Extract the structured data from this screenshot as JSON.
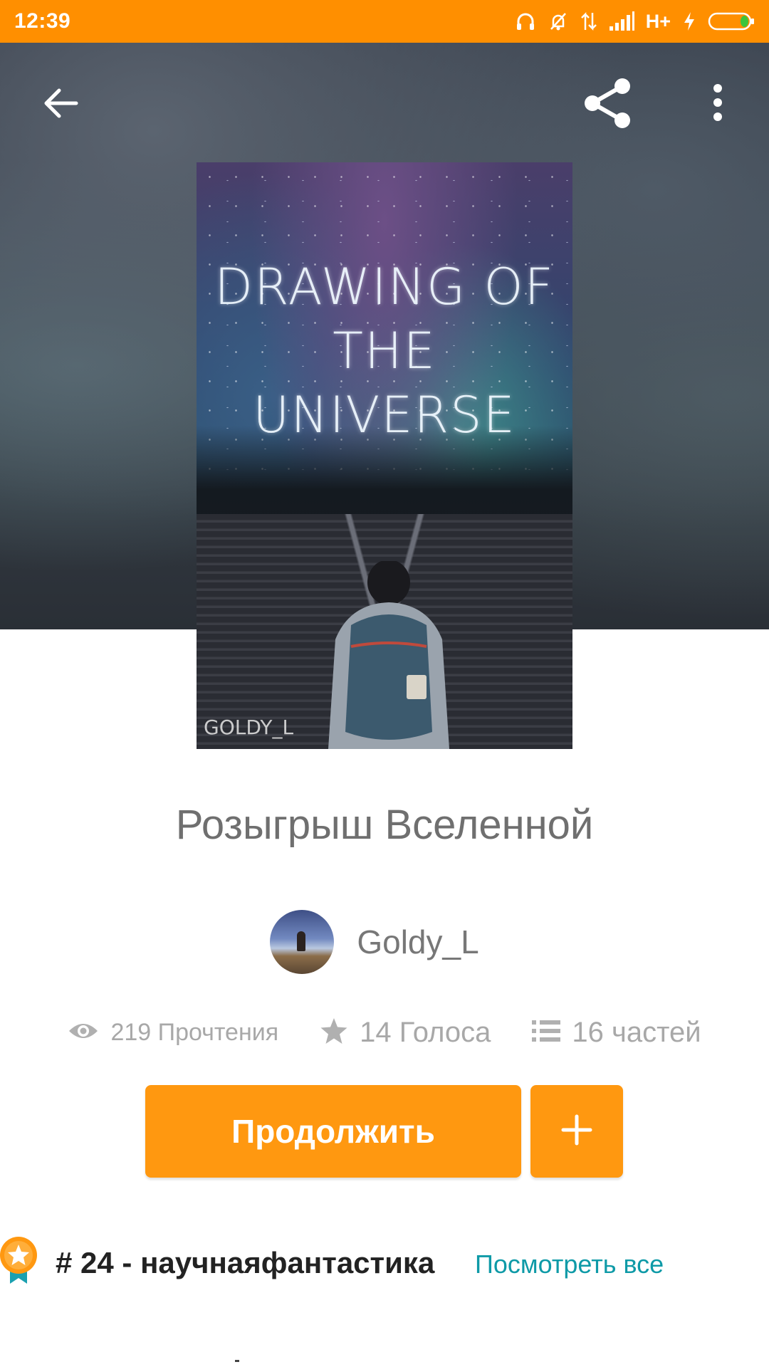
{
  "status_bar": {
    "time": "12:39",
    "network": "H+",
    "icons": [
      "headset-icon",
      "bell-off-icon",
      "data-arrows-icon",
      "signal-icon",
      "charging-icon",
      "battery-icon"
    ]
  },
  "toolbar": {
    "icons": [
      "back-arrow-icon",
      "share-icon",
      "more-vert-icon"
    ]
  },
  "cover": {
    "title_line1": "DRAWING OF",
    "title_line2": "THE UNIVERSE",
    "author_mark": "GOLDY_L"
  },
  "story": {
    "title": "Розыгрыш Вселенной",
    "author": "Goldy_L"
  },
  "stats": {
    "reads": "219 Прочтения",
    "votes": "14 Голоса",
    "parts": "16 частей"
  },
  "actions": {
    "continue_label": "Продолжить",
    "add_label": "+"
  },
  "ranking": {
    "text": "# 24 - научнаяфантастика",
    "link": "Посмотреть все"
  },
  "colors": {
    "accent": "#ff9810",
    "status_bar": "#ff8f00",
    "link": "#0e9aa7"
  }
}
